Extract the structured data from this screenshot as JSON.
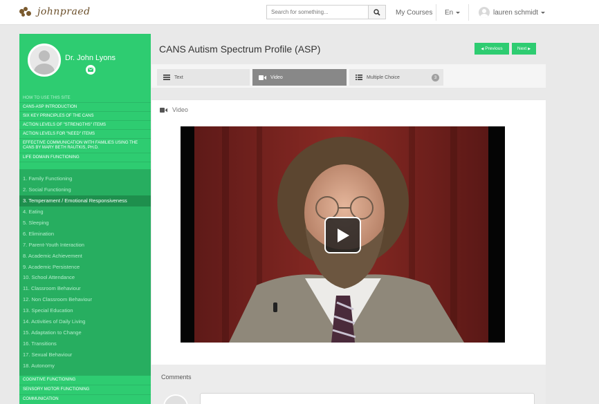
{
  "topbar": {
    "logo_text": "johnpraed",
    "search_placeholder": "Search for something...",
    "my_courses": "My Courses",
    "language": "En",
    "user_name": "lauren schmidt"
  },
  "sidebar": {
    "profile_name": "Dr. John Lyons",
    "top_items": [
      {
        "label": "HOW TO USE THIS SITE"
      },
      {
        "label": "CANS-ASP INTRODUCTION"
      },
      {
        "label": "SIX KEY PRINCIPLES OF THE CANS"
      },
      {
        "label": "ACTION LEVELS OF \"STRENGTHS\" ITEMS"
      },
      {
        "label": "ACTION LEVELS FOR \"NEED\" ITEMS"
      },
      {
        "label": "EFFECTIVE COMMUNICATION WITH FAMILIES USING THE CANS BY MARY BETH RAUTKIS, PH.D."
      },
      {
        "label": "LIFE DOMAIN FUNCTIONING"
      }
    ],
    "sub_items": [
      {
        "label": "1. Family Functioning"
      },
      {
        "label": "2. Social Functioning"
      },
      {
        "label": "3. Temperament / Emotional Responsiveness"
      },
      {
        "label": "4. Eating"
      },
      {
        "label": "5. Sleeping"
      },
      {
        "label": "6. Elimination"
      },
      {
        "label": "7. Parent-Youth Interaction"
      },
      {
        "label": "8. Academic Achievement"
      },
      {
        "label": "9. Academic Persistence"
      },
      {
        "label": "10. School Attendance"
      },
      {
        "label": "11. Classroom Behaviour"
      },
      {
        "label": "12. Non Classroom Behaviour"
      },
      {
        "label": "13. Special Education"
      },
      {
        "label": "14. Activities of Daily Living"
      },
      {
        "label": "15. Adaptation to Change"
      },
      {
        "label": "16. Transitions"
      },
      {
        "label": "17. Sexual Behaviour"
      },
      {
        "label": "18. Autonomy"
      }
    ],
    "active_index": 2,
    "bottom_items": [
      {
        "label": "COGNITIVE FUNCTIONING"
      },
      {
        "label": "SENSORY MOTOR FUNCTIONING"
      },
      {
        "label": "COMMUNICATION"
      }
    ]
  },
  "main": {
    "title": "CANS Autism Spectrum Profile (ASP)",
    "prev_label": "Previous",
    "next_label": "Next",
    "tabs": [
      {
        "label": "Text"
      },
      {
        "label": "Video"
      },
      {
        "label": "Multiple Choice",
        "badge": "3"
      }
    ],
    "section_label": "Video",
    "comments_title": "Comments"
  },
  "colors": {
    "accent_green": "#2ecc71",
    "sidebar_sub_bg": "#27ae60",
    "active_item_bg": "#1e8f4d",
    "active_tab_bg": "#888888"
  }
}
